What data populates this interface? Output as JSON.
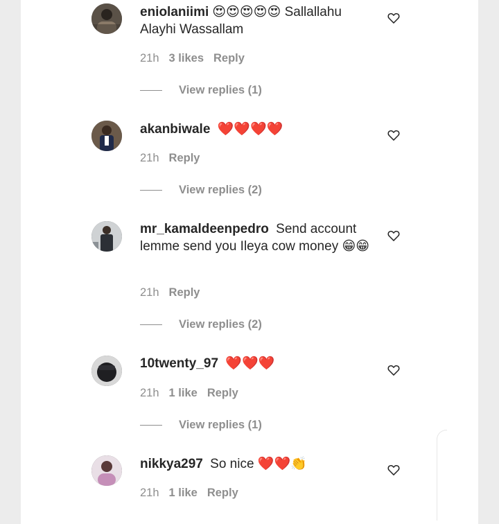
{
  "comments": [
    {
      "username": "eniolaniimi",
      "emoji_prefix": "😍😍😍😍😍",
      "text": "Sallallahu Alayhi Wassallam",
      "emoji_suffix": "",
      "time": "21h",
      "likes": "3 likes",
      "reply": "Reply",
      "view_replies": "View replies (1)",
      "avatar_color": "#5a5147"
    },
    {
      "username": "akanbiwale",
      "emoji_prefix": "❤️❤️❤️❤️",
      "text": "",
      "emoji_suffix": "",
      "time": "21h",
      "likes": "",
      "reply": "Reply",
      "view_replies": "View replies (2)",
      "avatar_color": "#2b2f3a"
    },
    {
      "username": "mr_kamaldeenpedro",
      "emoji_prefix": "",
      "text": "Send account lemme send you Ileya cow money",
      "emoji_suffix": "😁😁",
      "time": "21h",
      "likes": "",
      "reply": "Reply",
      "view_replies": "View replies (2)",
      "avatar_color": "#6c6f73"
    },
    {
      "username": "10twenty_97",
      "emoji_prefix": "❤️❤️❤️",
      "text": "",
      "emoji_suffix": "",
      "time": "21h",
      "likes": "1 like",
      "reply": "Reply",
      "view_replies": "View replies (1)",
      "avatar_color": "#1f1f22"
    },
    {
      "username": "nikkya297",
      "emoji_prefix": "",
      "text": "So nice",
      "emoji_suffix": "❤️❤️👏",
      "time": "21h",
      "likes": "1 like",
      "reply": "Reply",
      "view_replies": "",
      "avatar_color": "#c9b3c4"
    }
  ],
  "icons": {
    "like": "heart-outline-icon"
  },
  "colors": {
    "text": "#262626",
    "meta": "#8e8e8e",
    "background": "#ffffff"
  }
}
